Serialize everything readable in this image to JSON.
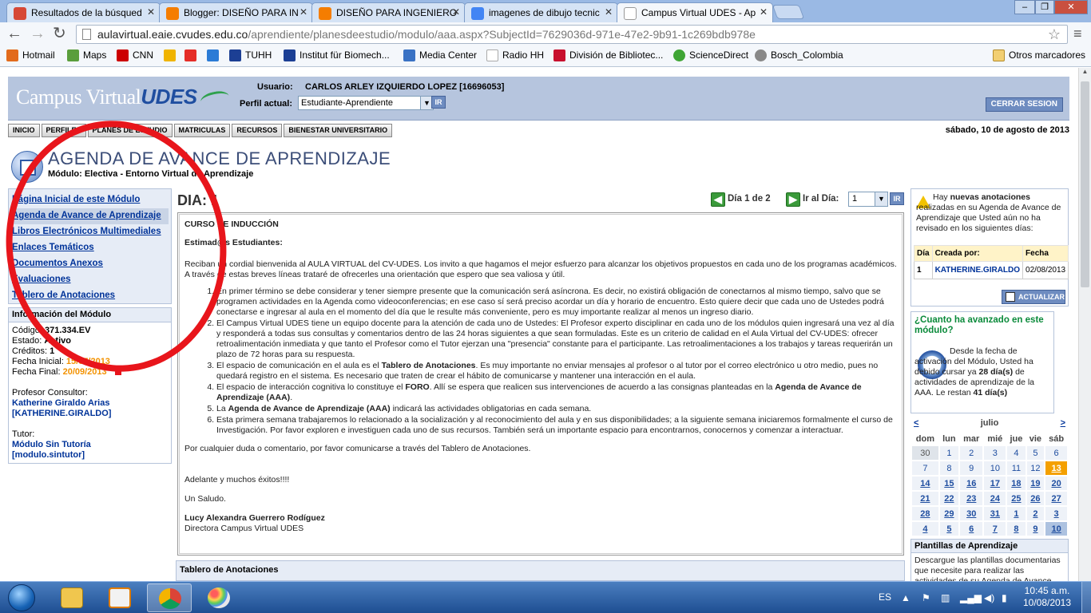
{
  "browser": {
    "tabs": [
      {
        "title": "Resultados de la búsqued",
        "favicon_color": "#d64836"
      },
      {
        "title": "Blogger: DISEÑO PARA IN",
        "favicon_color": "#f57d00"
      },
      {
        "title": "DISEÑO PARA INGENIERO",
        "favicon_color": "#f57d00"
      },
      {
        "title": "imagenes de dibujo tecnic",
        "favicon_color": "#4285f4"
      },
      {
        "title": "Campus Virtual UDES - Ap",
        "favicon_color": "#ffffff"
      }
    ],
    "url_host": "aulavirtual.eaie.cvudes.edu.co",
    "url_path": "/aprendiente/planesdeestudio/modulo/aaa.aspx?SubjectId=7629036d-971e-47e2-9b91-1c269bdb978e",
    "bookmarks": [
      {
        "label": "Hotmail",
        "color": "#e26b1c"
      },
      {
        "label": "Maps",
        "color": "#5a9e3c"
      },
      {
        "label": "CNN",
        "color": "#cc0000"
      },
      {
        "label": "",
        "color": "#f0b400"
      },
      {
        "label": "",
        "color": "#e52d27"
      },
      {
        "label": "",
        "color": "#2b7bd6"
      },
      {
        "label": "TUHH",
        "color": "#1c3f94"
      },
      {
        "label": "Institut für Biomech...",
        "color": "#1c3f94"
      },
      {
        "label": "Media Center",
        "color": "#3a72c4"
      },
      {
        "label": "Radio HH",
        "color": "#dddddd"
      },
      {
        "label": "División de Bibliotec...",
        "color": "#c8102e"
      },
      {
        "label": "ScienceDirect",
        "color": "#3fa535"
      },
      {
        "label": "Bosch_Colombia",
        "color": "#888888"
      }
    ],
    "other_bookmarks": "Otros marcadores"
  },
  "header": {
    "logo_text": "Campus Virtual",
    "logo_brand": "UDES",
    "usuario_label": "Usuario:",
    "usuario_value": "CARLOS ARLEY IZQUIERDO LOPEZ [16696053]",
    "perfil_label": "Perfil actual:",
    "perfil_value": "Estudiante-Aprendiente",
    "ir_label": "IR",
    "logout_label": "CERRAR SESION"
  },
  "menu": [
    "INICIO",
    "PERFILES",
    "PLANES DE ESTUDIO",
    "MATRICULAS",
    "RECURSOS",
    "BIENESTAR UNIVERSITARIO"
  ],
  "date": "sábado, 10 de agosto de 2013",
  "title": {
    "heading": "AGENDA DE AVANCE DE APRENDIZAJE",
    "modulo_label": "Módulo:",
    "modulo_value": "Electiva - Entorno Virtual de Aprendizaje"
  },
  "leftnav": [
    "Página Inicial de este Módulo",
    "Agenda de Avance de Aprendizaje",
    "Libros Electrónicos Multimediales",
    "Enlaces Temáticos",
    "Documentos Anexos",
    "Evaluaciones",
    "Tablero de Anotaciones"
  ],
  "modinfo": {
    "heading": "Información del Módulo",
    "codigo_label": "Código:",
    "codigo_value": "371.334.EV",
    "estado_label": "Estado:",
    "estado_value": "Activo",
    "creditos_label": "Créditos:",
    "creditos_value": "1",
    "fecha_inicial_label": "Fecha Inicial:",
    "fecha_inicial_value": "15/07/2013",
    "fecha_final_label": "Fecha Final:",
    "fecha_final_value": "20/09/2013",
    "profesor_label": "Profesor Consultor:",
    "profesor_name": "Katherine Giraldo Arias",
    "profesor_user": "[KATHERINE.GIRALDO]",
    "tutor_label": "Tutor:",
    "tutor_name": "Módulo Sin Tutoría",
    "tutor_user": "[modulo.sintutor]"
  },
  "main": {
    "dia_label": "DIA: 1",
    "day_count": "Día 1 de 2",
    "ir_al_dia": "Ir al Día:",
    "day_select": "1",
    "ir_btn": "IR",
    "curso": "CURSO DE INDUCCIÓN",
    "saludo": "Estimad@s Estudiantes:",
    "intro": "Reciban un cordial bienvenida al AULA VIRTUAL del CV-UDES. Los invito a que hagamos el mejor esfuerzo para alcanzar los objetivos propuestos en cada uno de los programas académicos. A través de estas breves líneas trataré de ofrecerles una orientación que espero que sea valiosa y útil.",
    "items": [
      {
        "a": "En primer término se debe considerar y tener siempre presente que la comunicación será asíncrona. Es decir, no existirá obligación de conectarnos al mismo tiempo, salvo que se programen actividades en la Agenda como videoconferencias; en ese caso sí será preciso acordar un día y horario de encuentro. Esto quiere decir que cada uno de Ustedes podrá conectarse e ingresar al aula en el momento del día que le resulte más conveniente, pero es muy importante realizar al menos un ingreso diario.",
        "b": "",
        "c": ""
      },
      {
        "a": "El Campus Virtual UDES tiene un equipo docente para la atención de cada uno de Ustedes: El Profesor experto disciplinar en cada uno de los módulos quien ingresará una vez al día y responderá a todas sus consultas y comentarios dentro de las 24 horas siguientes a que sean formuladas. Este es un criterio de calidad en el Aula Virtual del CV-UDES: ofrecer retroalimentación inmediata y que tanto el Profesor como el Tutor ejerzan una \"presencia\" constante para el participante. Las retroalimentaciones a los trabajos y tareas requerirán un plazo de 72 horas para su respuesta.",
        "b": "",
        "c": ""
      },
      {
        "a": "El espacio de comunicación en el aula es el ",
        "b": "Tablero de Anotaciones",
        "c": ". Es muy importante no enviar mensajes al profesor o al tutor por el correo electrónico u otro medio, pues no quedará registro en el sistema. Es necesario que traten de crear el hábito de comunicarse y mantener una interacción en el aula."
      },
      {
        "a": "El espacio de interacción cognitiva lo constituye el ",
        "b": "FORO",
        "c": ". Allí se espera que realicen sus intervenciones de acuerdo a las consignas planteadas en la "
      },
      {
        "a": "La ",
        "b": "Agenda de Avance de Aprendizaje (AAA)",
        "c": " indicará las actividades obligatorias en cada semana."
      },
      {
        "a": "Esta primera semana trabajaremos lo relacionado a la socialización y al reconocimiento del aula y en sus disponibilidades; a la siguiente semana iniciaremos formalmente el curso de Investigación. Por favor exploren e investiguen cada uno de sus recursos. También será un importante espacio para encontrarnos, conocernos y comenzar a interactuar.",
        "b": "",
        "c": ""
      }
    ],
    "item4_tail": "Agenda de Avance de Aprendizaje (AAA)",
    "dudas": "Por cualquier duda o comentario, por favor comunicarse a través del Tablero de Anotaciones.",
    "adelante": "Adelante y muchos éxitos!!!!",
    "un_saludo": "Un Saludo.",
    "firma_nombre": "Lucy Alexandra Guerrero Rodíguez",
    "firma_cargo": "Directora Campus Virtual UDES",
    "tablero_heading": "Tablero de Anotaciones"
  },
  "notes": {
    "pre": "Hay ",
    "bold": "nuevas anotaciones",
    "post": " realizadas en su Agenda de Avance de Aprendizaje que Usted aún no ha revisado en los siguientes días:",
    "col_dia": "Día",
    "col_creada": "Creada por:",
    "col_fecha": "Fecha",
    "row_dia": "1",
    "row_user": "KATHERINE.GIRALDO",
    "row_fecha": "02/08/2013",
    "actualizar": "ACTUALIZAR"
  },
  "progress": {
    "heading": "¿Cuanto ha avanzado en este módulo?",
    "t1": "Desde la fecha de activación del Módulo, Usted ha debido cursar ya ",
    "t2": "28 día(s)",
    "t3": " de actividades de aprendizaje de la AAA. Le restan ",
    "t4": "41 día(s)"
  },
  "calendar": {
    "prev": "<",
    "month": "julio",
    "next": ">",
    "days": [
      "dom",
      "lun",
      "mar",
      "mié",
      "jue",
      "vie",
      "sáb"
    ],
    "weeks": [
      [
        {
          "d": "30",
          "t": "other"
        },
        {
          "d": "1",
          "t": "past"
        },
        {
          "d": "2",
          "t": "past"
        },
        {
          "d": "3",
          "t": "past"
        },
        {
          "d": "4",
          "t": "past"
        },
        {
          "d": "5",
          "t": "past"
        },
        {
          "d": "6",
          "t": "past"
        }
      ],
      [
        {
          "d": "7",
          "t": "past"
        },
        {
          "d": "8",
          "t": "past"
        },
        {
          "d": "9",
          "t": "past"
        },
        {
          "d": "10",
          "t": "past"
        },
        {
          "d": "11",
          "t": "past"
        },
        {
          "d": "12",
          "t": "past"
        },
        {
          "d": "13",
          "t": "today"
        }
      ],
      [
        {
          "d": "14",
          "t": "future"
        },
        {
          "d": "15",
          "t": "future"
        },
        {
          "d": "16",
          "t": "future"
        },
        {
          "d": "17",
          "t": "future"
        },
        {
          "d": "18",
          "t": "future"
        },
        {
          "d": "19",
          "t": "future"
        },
        {
          "d": "20",
          "t": "future"
        }
      ],
      [
        {
          "d": "21",
          "t": "future"
        },
        {
          "d": "22",
          "t": "future"
        },
        {
          "d": "23",
          "t": "future"
        },
        {
          "d": "24",
          "t": "future"
        },
        {
          "d": "25",
          "t": "future"
        },
        {
          "d": "26",
          "t": "future"
        },
        {
          "d": "27",
          "t": "future"
        }
      ],
      [
        {
          "d": "28",
          "t": "future"
        },
        {
          "d": "29",
          "t": "future"
        },
        {
          "d": "30",
          "t": "future"
        },
        {
          "d": "31",
          "t": "future"
        },
        {
          "d": "1",
          "t": "future"
        },
        {
          "d": "2",
          "t": "future"
        },
        {
          "d": "3",
          "t": "future"
        }
      ],
      [
        {
          "d": "4",
          "t": "future"
        },
        {
          "d": "5",
          "t": "future"
        },
        {
          "d": "6",
          "t": "future"
        },
        {
          "d": "7",
          "t": "future"
        },
        {
          "d": "8",
          "t": "future"
        },
        {
          "d": "9",
          "t": "future"
        },
        {
          "d": "10",
          "t": "sel"
        }
      ]
    ]
  },
  "plantillas": {
    "heading": "Plantillas de Aprendizaje",
    "text": "Descargue las plantillas documentarias que necesite para realizar las actividades de su Agenda de Avance"
  },
  "taskbar": {
    "lang": "ES",
    "time": "10:45 a.m.",
    "date": "10/08/2013"
  }
}
